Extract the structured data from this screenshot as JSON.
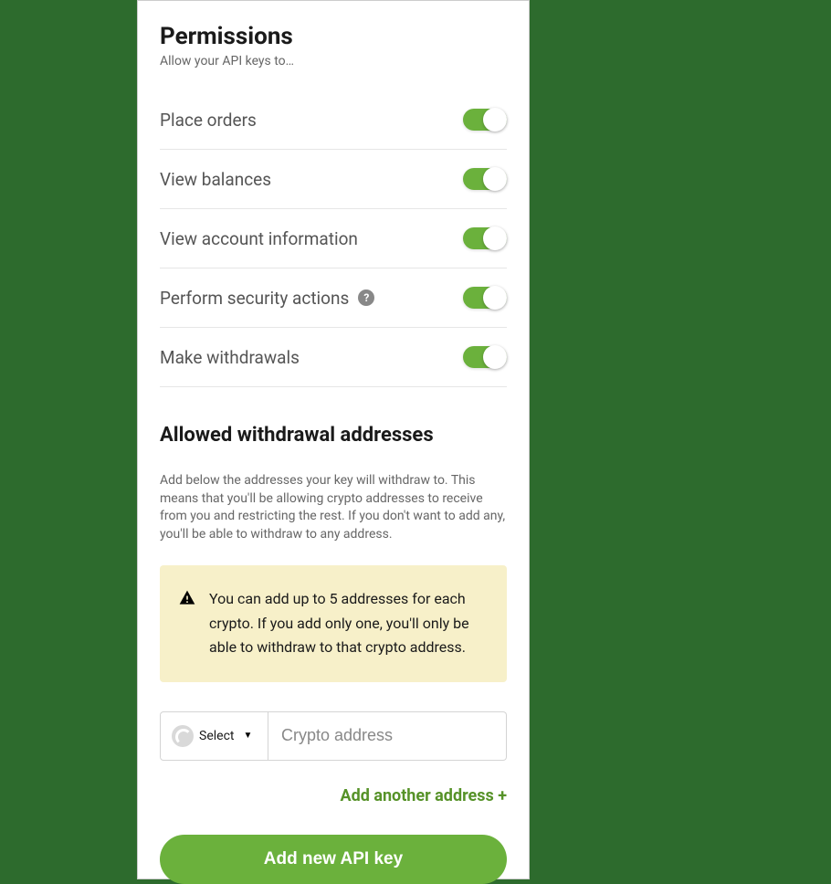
{
  "header": {
    "title": "Permissions",
    "subtitle": "Allow your API keys to…"
  },
  "permissions": [
    {
      "label": "Place orders",
      "has_help": false,
      "enabled": true
    },
    {
      "label": "View balances",
      "has_help": false,
      "enabled": true
    },
    {
      "label": "View account information",
      "has_help": false,
      "enabled": true
    },
    {
      "label": "Perform security actions",
      "has_help": true,
      "enabled": true
    },
    {
      "label": "Make withdrawals",
      "has_help": false,
      "enabled": true
    }
  ],
  "withdrawal": {
    "title": "Allowed withdrawal addresses",
    "description": "Add below the addresses your key will withdraw to. This means that you'll be allowing crypto addresses to receive from you and restricting the rest. If you don't want to add any, you'll be able to withdraw to any address.",
    "alert": "You can add up to 5 addresses for each crypto. If you add only one, you'll only be able to withdraw to that crypto address.",
    "select_label": "Select",
    "address_placeholder": "Crypto address",
    "add_another_label": "Add another address +"
  },
  "submit_label": "Add new API key",
  "help_glyph": "?"
}
